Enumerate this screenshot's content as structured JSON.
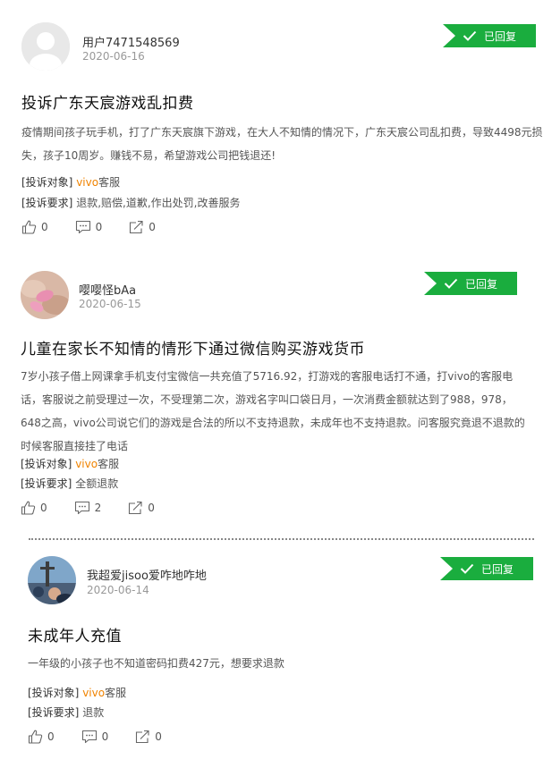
{
  "posts": [
    {
      "username": "用户7471548569",
      "date": "2020-06-16",
      "status": "已回复",
      "title": "投诉广东天宸游戏乱扣费",
      "body": "疫情期间孩子玩手机，打了广东天宸旗下游戏，在大人不知情的情况下，广东天宸公司乱扣费，导致4498元损失，孩子10周岁。赚钱不易，希望游戏公司把钱退还!",
      "target_label": "[投诉对象]",
      "target_brand": "vivo",
      "target_rest": "客服",
      "request_label": "[投诉要求]",
      "request": "退款,赔偿,道歉,作出处罚,改善服务",
      "likes": "0",
      "comments": "0",
      "shares": "0"
    },
    {
      "username": "嘤嘤怪bAa",
      "date": "2020-06-15",
      "status": "已回复",
      "title": "儿童在家长不知情的情形下通过微信购买游戏货币",
      "body": "7岁小孩子借上网课拿手机支付宝微信一共充值了5716.92，打游戏的客服电话打不通，打vivo的客服电话，客服说之前受理过一次，不受理第二次，游戏名字叫口袋日月，一次消费金额就达到了988，978，648之高，vivo公司说它们的游戏是合法的所以不支持退款，未成年也不支持退款。问客服究竟退不退款的时候客服直接挂了电话",
      "target_label": "[投诉对象]",
      "target_brand": "vivo",
      "target_rest": "客服",
      "request_label": "[投诉要求]",
      "request": "全额退款",
      "likes": "0",
      "comments": "2",
      "shares": "0"
    },
    {
      "username": "我超爱jisoo爱咋地咋地",
      "date": "2020-06-14",
      "status": "已回复",
      "title": "未成年人充值",
      "body": "一年级的小孩子也不知道密码扣费427元，想要求退款",
      "target_label": "[投诉对象]",
      "target_brand": "vivo",
      "target_rest": "客服",
      "request_label": "[投诉要求]",
      "request": "退款",
      "likes": "0",
      "comments": "0",
      "shares": "0"
    }
  ],
  "colors": {
    "badge": "#1aad3e",
    "brand": "#f08300"
  },
  "icons": {
    "status": "checkmark-icon",
    "like": "thumbs-up-icon",
    "comment": "comment-icon",
    "share": "share-icon"
  }
}
